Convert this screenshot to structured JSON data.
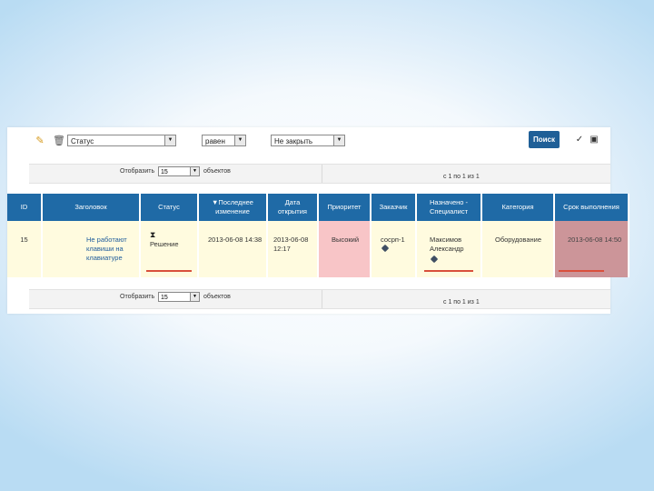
{
  "toolbar": {
    "status_select": "Статус",
    "mode_select": "равен",
    "value_select": "Не закрыть",
    "search_label": "Поиск"
  },
  "pager": {
    "show_label": "Отобразить",
    "page_size": "15",
    "items_label": "объектов",
    "page_info": "с 1 по 1 из 1"
  },
  "table": {
    "columns": [
      "ID",
      "Заголовок",
      "Статус",
      "▼Последнее изменение",
      "Дата открытия",
      "Приоритет",
      "Заказчик",
      "Назначено - Специалист",
      "Категория",
      "Срок выполнения"
    ],
    "row": {
      "id": "15",
      "title": "Не работают клавиши на клавиатуре",
      "status": "Решение",
      "last_change": "2013-06-08 14:38",
      "opened": "2013-06-08 12:17",
      "priority": "Высокий",
      "customer": "сосрп-1",
      "assignee": "Максимов Александр",
      "category": "Оборудование",
      "due": "2013-06-08 14:50"
    }
  }
}
